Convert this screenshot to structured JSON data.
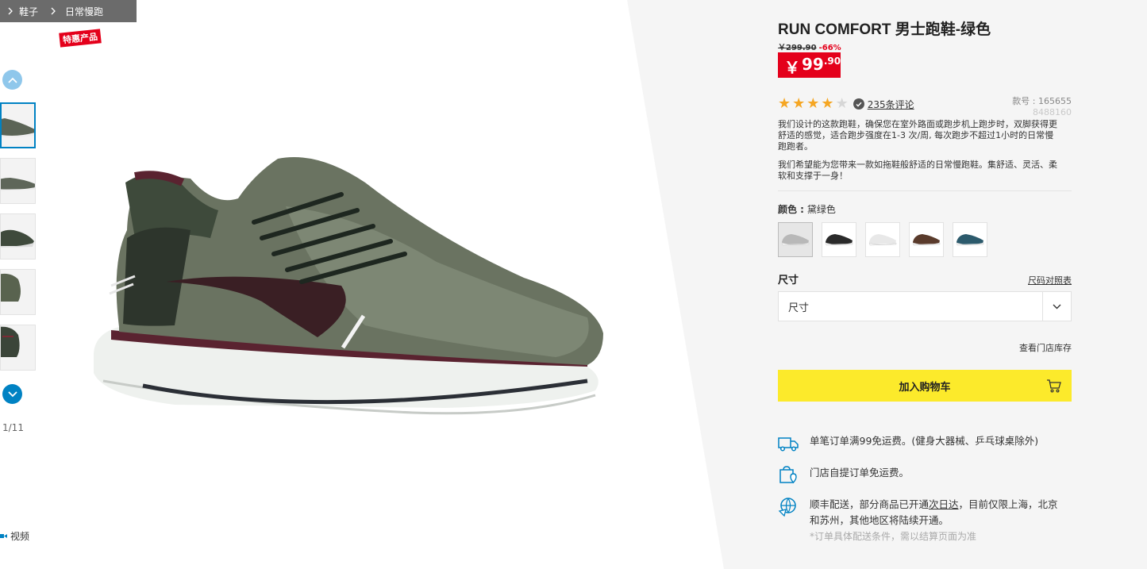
{
  "breadcrumb": [
    "鞋子",
    "日常慢跑"
  ],
  "promo_tag": "特惠产品",
  "gallery": {
    "counter": "1/11",
    "video_label": "视频"
  },
  "product": {
    "title": "RUN COMFORT 男士跑鞋-绿色",
    "old_price": "￥299.90",
    "discount": "-66%",
    "price_symbol": "￥",
    "price_integer": "99",
    "price_decimal": ".90",
    "rating": 4,
    "rating_max": 5,
    "reviews_label": "235条评论",
    "sku_label": "款号 : 165655",
    "sku_sub": "8488160",
    "description": [
      "我们设计的这款跑鞋，确保您在室外路面或跑步机上跑步时，双脚获得更舒适的感觉，适合跑步强度在1-3 次/周, 每次跑步不超过1小时的日常慢跑跑者。",
      "我们希望能为您带来一款如拖鞋般舒适的日常慢跑鞋。集舒适、灵活、柔软和支撑于一身！"
    ],
    "color_label": "颜色 :",
    "color_value": "黛绿色",
    "swatch_colors": [
      "#b8b8b8",
      "#2a2a2a",
      "#e8e8e8",
      "#5a3b2c",
      "#2c5a6c"
    ],
    "size_label": "尺寸",
    "size_guide": "尺码对照表",
    "size_placeholder": "尺寸",
    "store_stock": "查看门店库存",
    "add_to_cart": "加入购物车"
  },
  "perks": {
    "shipping": "单笔订单满99免运费。(健身大器械、乒乓球桌除外)",
    "pickup": "门店自提订单免运费。",
    "express_pre": "顺丰配送，部分商品已开通",
    "express_link": "次日达",
    "express_post": "，目前仅限上海，北京和苏州，其他地区将陆续开通。",
    "express_note": "*订单具体配送条件，需以结算页面为准"
  },
  "colors": {
    "accent_blue": "#0082c3",
    "price_red": "#e4001b",
    "cart_yellow": "#fcea2b",
    "star_orange": "#f5a623"
  }
}
